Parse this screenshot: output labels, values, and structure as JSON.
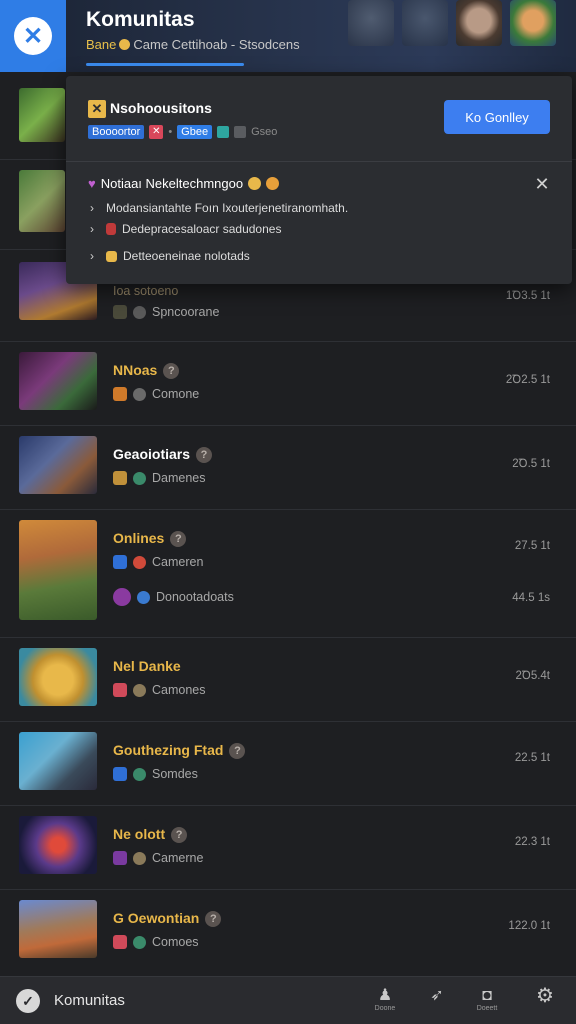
{
  "header": {
    "title": "Komunitas",
    "subtitle_first": "Bane",
    "subtitle_rest": "Came  Cettihoab  -  Stsodcens",
    "logo_glyph": "✕",
    "accent": "#2f7de6"
  },
  "popup": {
    "title": "Nsohoousitons",
    "tag_1": "Boooortor",
    "tag_2": "Gbee",
    "tag_3": "Gseo",
    "button_label": "Ko Gonlley",
    "notice_title": "Notiaaı Nekeltechmngoo",
    "lines": [
      {
        "icon": "",
        "text": "Modansiantahte Foın Ixouterjenetiranomhath."
      },
      {
        "icon": "red",
        "text": "Dedepracesaloacr sadudones"
      },
      {
        "icon": "gold",
        "text": "Detteoeneinae nolotads"
      }
    ]
  },
  "games": [
    {
      "name": "",
      "meta": "",
      "meta2": "",
      "value": ""
    },
    {
      "name": "",
      "meta": "",
      "meta2": "",
      "value": ""
    },
    {
      "name": "Ioa sotoeno",
      "meta": "Spncoorane",
      "meta2": "",
      "value": "1Ꝺ3.5 1t"
    },
    {
      "name": "NNoas",
      "meta": "Comone",
      "meta2": "",
      "value": "2Ꝺ2.5 1t"
    },
    {
      "name": "Geaoiotiars",
      "meta": "Damenes",
      "meta2": "",
      "value": "2Ꝺ.5 1t"
    },
    {
      "name": "Onlines",
      "meta": "Cameren",
      "meta2": "Donootadoats",
      "value": "27.5 1t",
      "value2": "44.5 1s"
    },
    {
      "name": "Nel Danke",
      "meta": "Camones",
      "meta2": "",
      "value": "2Ꝺ5.4t"
    },
    {
      "name": "Gouthezing Ftad",
      "meta": "Somdes",
      "meta2": "",
      "value": "22.5 1t"
    },
    {
      "name": "Ne olott",
      "meta": "Camerne",
      "meta2": "",
      "value": "22.3 1t"
    },
    {
      "name": "G Oewontian",
      "meta": "Comoes",
      "meta2": "",
      "value": "122.0 1t"
    }
  ],
  "bottom": {
    "title": "Komunitas",
    "icons": [
      {
        "name": "people-icon",
        "glyph": "♟",
        "label": "Doone"
      },
      {
        "name": "rocket-icon",
        "glyph": "➶",
        "label": ""
      },
      {
        "name": "chat-icon",
        "glyph": "◘",
        "label": "Doeett"
      },
      {
        "name": "settings-icon",
        "glyph": "⚙",
        "label": ""
      }
    ]
  }
}
